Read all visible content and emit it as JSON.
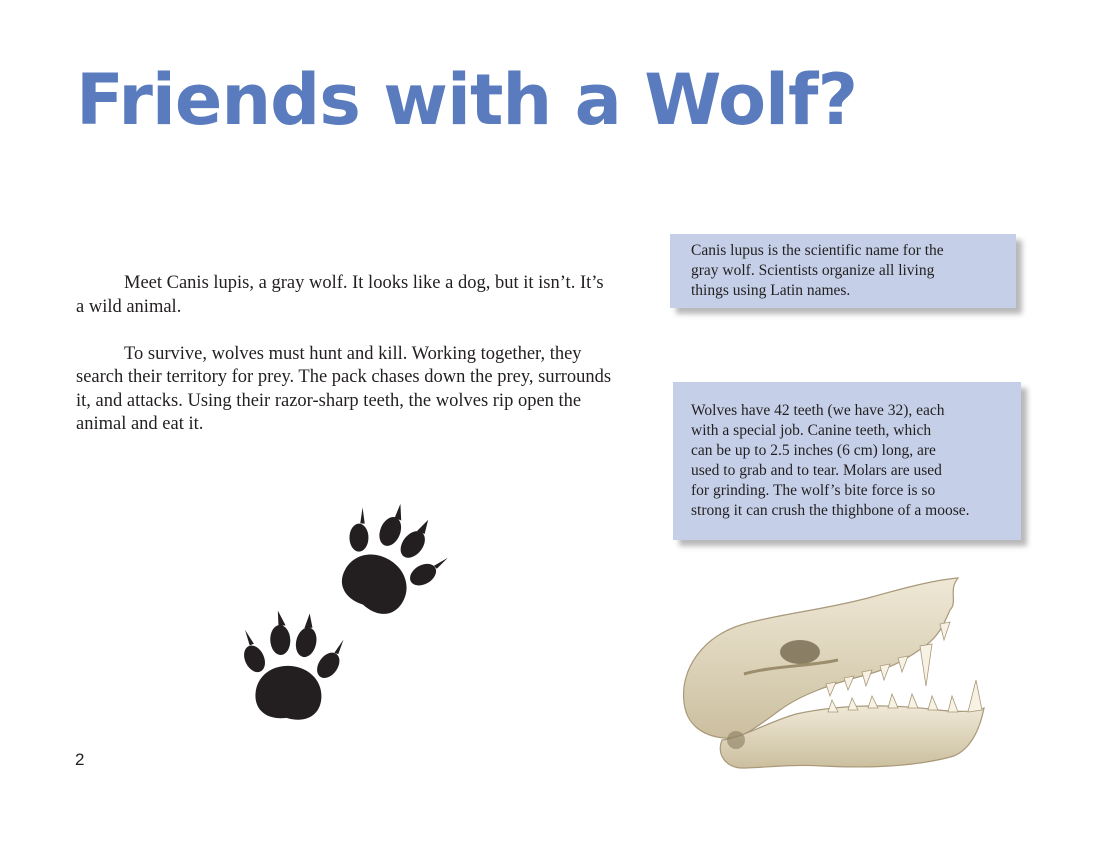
{
  "page": {
    "title": "Friends with a Wolf?",
    "page_number": "2",
    "accent_color": "#5a7bbd",
    "box_color": "#c5d0e8"
  },
  "body": {
    "paragraphs": [
      "Meet Canis lupis, a gray wolf. It looks like a dog, but it isn’t. It’s a wild animal.",
      "To survive, wolves must hunt and kill. Working together, they search their territory for prey. The pack chases down the prey, surrounds it, and attacks. Using their razor-sharp teeth, the wolves rip open the animal and eat it."
    ]
  },
  "sidebars": [
    {
      "text": "Canis lupus is the scientific name for the\ngray wolf. Scientists organize all living\nthings using Latin names."
    },
    {
      "text": "Wolves have 42 teeth (we have 32), each\nwith a special job. Canine teeth, which\n can be up to 2.5 inches (6 cm) long, are\nused to grab and to tear.  Molars are used\nfor grinding. The wolf’s bite force is so\nstrong it can crush the thighbone of a moose."
    }
  ],
  "images": {
    "paw_prints": "paw-prints-icon",
    "skull": "wolf-skull-photo"
  }
}
